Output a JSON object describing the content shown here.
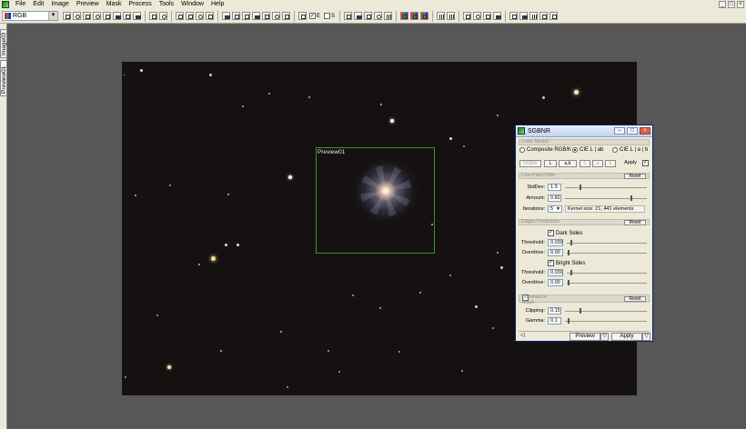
{
  "menubar": {
    "items": [
      "File",
      "Edit",
      "Image",
      "Preview",
      "Mask",
      "Process",
      "Tools",
      "Window",
      "Help"
    ],
    "window_controls": [
      "_",
      "□",
      "×"
    ]
  },
  "toolbar": {
    "color_space": "RGB",
    "check_e_label": "E",
    "check_s_label": "S"
  },
  "side_tabs": {
    "image_tab": "Image03",
    "preview_tab": "Preview01"
  },
  "image": {
    "preview_label": "Preview01"
  },
  "dialog": {
    "title": "SGBNR",
    "title_buttons": [
      "–",
      "□",
      "×"
    ],
    "color_model": {
      "header": "Color Model",
      "options": [
        "Composite RGB/K",
        "CIE L | ab",
        "CIE L | a | b"
      ],
      "selected": "CIE L | ab",
      "apply_label": "Apply",
      "apply_checked": "✓",
      "channels": [
        "RGB/K",
        "L",
        "a,b",
        "L",
        "a",
        "b"
      ]
    },
    "low_pass": {
      "header": "Low-Pass Filter",
      "reset": "Reset",
      "stddev_label": "StdDev:",
      "stddev": "1.9",
      "amount_label": "Amount:",
      "amount": "0.82",
      "iterations_label": "Iterations:",
      "iterations": "5",
      "kernel_text": "Kernel size: 21, 441 elements"
    },
    "edges": {
      "header": "Edges Protection",
      "reset": "Reset",
      "dark_label": "Dark Sides",
      "dark_checked": "✓",
      "threshold_label": "Threshold:",
      "dark_threshold": "0.030",
      "overdrive_label": "Overdrive:",
      "dark_overdrive": "0.00",
      "bright_label": "Bright Sides",
      "bright_checked": "✓",
      "bright_threshold": "0.030",
      "bright_overdrive": "0.00"
    },
    "luminance": {
      "label": "Luminance Mask",
      "checked": "✓",
      "reset": "Reset",
      "clipping_label": "Clipping:",
      "clipping": "0.15",
      "gamma_label": "Gamma:",
      "gamma": "0.1"
    },
    "bottom": {
      "preview_label": "Preview",
      "apply_label": "Apply"
    }
  }
}
